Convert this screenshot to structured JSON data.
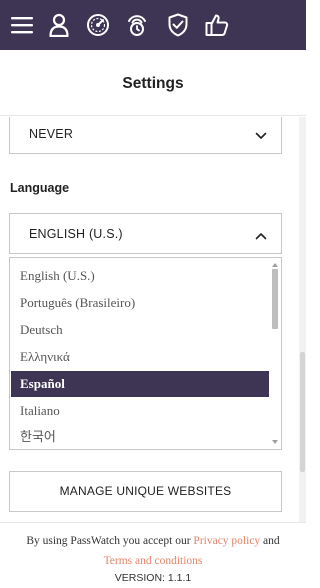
{
  "topbar": {
    "background": "#3d3553",
    "icons": [
      "hamburger-menu-icon",
      "user-icon",
      "dashboard-icon",
      "tracking-icon",
      "shield-check-icon",
      "thumbs-up-icon"
    ]
  },
  "header": {
    "title": "Settings"
  },
  "settings": {
    "previous_select_value": "NEVER",
    "language_label": "Language",
    "language_select_value": "ENGLISH (U.S.)",
    "language_options": [
      "English (U.S.)",
      "Português (Brasileiro)",
      "Deutsch",
      "Ελληνικά",
      "Español",
      "Italiano",
      "한국어"
    ],
    "highlighted_option": "Español",
    "manage_button_label": "MANAGE UNIQUE WEBSITES"
  },
  "footer": {
    "terms_prefix": "By using PassWatch you accept our",
    "privacy_link": "Privacy policy",
    "and": "and",
    "terms_link": "Terms and conditions",
    "version": "VERSION: 1.1.1",
    "link_color": "#e0846a"
  }
}
